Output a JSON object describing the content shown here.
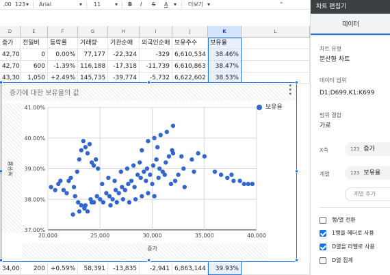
{
  "toolbar": {
    "decimals": ".00",
    "format_123": "123",
    "font": "Arial",
    "size": "11",
    "bold": "B",
    "italic": "I",
    "strike": "S",
    "textcolor": "A",
    "more": "더보기",
    "collapse": "⌃"
  },
  "grid": {
    "columns": [
      "D",
      "E",
      "F",
      "G",
      "H",
      "I",
      "J",
      "K",
      "L"
    ],
    "header_row": [
      "증가",
      "전일비",
      "등락률",
      "거래량",
      "기관순매",
      "외국인순매",
      "보유주수",
      "보유율"
    ],
    "rows": [
      [
        "42,700",
        "0",
        "0.00%",
        "77,177",
        "-22,324",
        "-329",
        "6,610,534",
        "38.46%"
      ],
      [
        "42,700",
        "600",
        "-1.39%",
        "116,188",
        "-17,318",
        "-11,739",
        "6,610,863",
        "38.47%"
      ],
      [
        "43,300",
        "1,050",
        "+2.49%",
        "145,735",
        "-39,774",
        "-5,732",
        "6,622,602",
        "38.53%"
      ]
    ],
    "bottom_row": [
      "34,000",
      "200",
      "+0.59%",
      "58,391",
      "-13,835",
      "-2,941",
      "6,863,144",
      "39.93%"
    ]
  },
  "chart": {
    "title": "증가에 대한 보유율의 값",
    "menu": "⋮",
    "legend": "보유율",
    "color": "#3366cc"
  },
  "chart_data": {
    "type": "scatter",
    "title": "증가에 대한 보유율의 값",
    "xlabel": "증가",
    "ylabel": "보유율",
    "xlim": [
      20000,
      40000
    ],
    "ylim": [
      37,
      41
    ],
    "x_ticks": [
      "20,000",
      "25,000",
      "30,000",
      "35,000",
      "40,000"
    ],
    "y_ticks": [
      "37.00%",
      "38.00%",
      "39.00%",
      "40.00%",
      "41.00%"
    ],
    "legend": "top-right",
    "grid": true,
    "series": [
      {
        "name": "보유율",
        "points": [
          [
            20300,
            38.4
          ],
          [
            20700,
            38.3
          ],
          [
            21000,
            38.5
          ],
          [
            21200,
            38.6
          ],
          [
            21500,
            38.3
          ],
          [
            21800,
            38.2
          ],
          [
            22000,
            38.6
          ],
          [
            22200,
            38.7
          ],
          [
            22500,
            38.4
          ],
          [
            22800,
            38.9
          ],
          [
            23000,
            39.3
          ],
          [
            23200,
            39.6
          ],
          [
            23400,
            39.9
          ],
          [
            23600,
            39.7
          ],
          [
            23800,
            39.5
          ],
          [
            24000,
            39.8
          ],
          [
            24200,
            39.2
          ],
          [
            24400,
            39.1
          ],
          [
            24600,
            39.3
          ],
          [
            24800,
            39.0
          ],
          [
            22600,
            38.1
          ],
          [
            22900,
            37.9
          ],
          [
            23200,
            37.8
          ],
          [
            23500,
            37.7
          ],
          [
            23800,
            37.6
          ],
          [
            24100,
            38.0
          ],
          [
            24400,
            37.9
          ],
          [
            24700,
            38.1
          ],
          [
            25000,
            38.0
          ],
          [
            25300,
            37.9
          ],
          [
            25600,
            38.2
          ],
          [
            25900,
            38.1
          ],
          [
            26200,
            38.0
          ],
          [
            26500,
            38.3
          ],
          [
            26800,
            38.2
          ],
          [
            27100,
            38.4
          ],
          [
            27400,
            38.3
          ],
          [
            27700,
            38.5
          ],
          [
            28000,
            38.6
          ],
          [
            28300,
            38.4
          ],
          [
            28600,
            38.8
          ],
          [
            28900,
            38.7
          ],
          [
            29200,
            38.9
          ],
          [
            29500,
            39.0
          ],
          [
            29800,
            38.8
          ],
          [
            30100,
            39.1
          ],
          [
            30400,
            39.3
          ],
          [
            30700,
            39.0
          ],
          [
            31000,
            38.9
          ],
          [
            31300,
            39.2
          ],
          [
            31600,
            39.4
          ],
          [
            31900,
            39.6
          ],
          [
            32200,
            38.6
          ],
          [
            32500,
            38.8
          ],
          [
            32800,
            39.4
          ],
          [
            33100,
            38.4
          ],
          [
            25200,
            38.5
          ],
          [
            25800,
            38.7
          ],
          [
            26400,
            38.6
          ],
          [
            27000,
            38.9
          ],
          [
            27600,
            39.0
          ],
          [
            28200,
            39.1
          ],
          [
            28800,
            39.2
          ],
          [
            29400,
            38.6
          ],
          [
            30000,
            38.5
          ],
          [
            30600,
            38.7
          ],
          [
            31200,
            38.8
          ],
          [
            31800,
            38.5
          ],
          [
            29000,
            39.6
          ],
          [
            29600,
            39.9
          ],
          [
            30200,
            40.0
          ],
          [
            30800,
            40.1
          ],
          [
            31400,
            40.2
          ],
          [
            32000,
            40.4
          ],
          [
            27800,
            37.9
          ],
          [
            28400,
            38.0
          ],
          [
            29000,
            38.1
          ],
          [
            29600,
            38.2
          ],
          [
            30200,
            38.1
          ],
          [
            26000,
            37.8
          ],
          [
            26600,
            37.9
          ],
          [
            27200,
            38.0
          ],
          [
            22400,
            37.5
          ],
          [
            23000,
            37.6
          ],
          [
            23600,
            37.8
          ],
          [
            24200,
            37.9
          ],
          [
            36000,
            38.9
          ],
          [
            36600,
            38.8
          ],
          [
            37200,
            38.7
          ],
          [
            37600,
            38.8
          ],
          [
            37800,
            38.6
          ],
          [
            38400,
            38.6
          ],
          [
            38800,
            38.5
          ],
          [
            39200,
            38.5
          ],
          [
            39600,
            38.5
          ],
          [
            33800,
            39.3
          ],
          [
            34400,
            39.5
          ],
          [
            35000,
            39.4
          ],
          [
            30500,
            39.7
          ],
          [
            32000,
            39.5
          ],
          [
            33000,
            39.0
          ],
          [
            34000,
            38.9
          ]
        ]
      }
    ]
  },
  "panel": {
    "title": "차트 편집기",
    "tab": "데이터",
    "chart_type_label": "차트 유형",
    "chart_type_value": "분산형 차트",
    "range_label": "데이터 범위",
    "range_value": "D1:D699,K1:K699",
    "combine_label": "범위 결합",
    "combine_value": "가로",
    "xaxis_label": "X축",
    "xaxis_chip_icon": "123",
    "xaxis_chip": "증가",
    "series_label": "계열",
    "series_chip_icon": "123",
    "series_chip": "보유율",
    "add_series": "계열 추가",
    "checks": [
      {
        "label": "행/열 전환",
        "checked": false
      },
      {
        "label": "1행을 헤더로 사용",
        "checked": true
      },
      {
        "label": "D열을 라벨로 사용",
        "checked": true
      },
      {
        "label": "D열 집계",
        "checked": false
      }
    ]
  }
}
